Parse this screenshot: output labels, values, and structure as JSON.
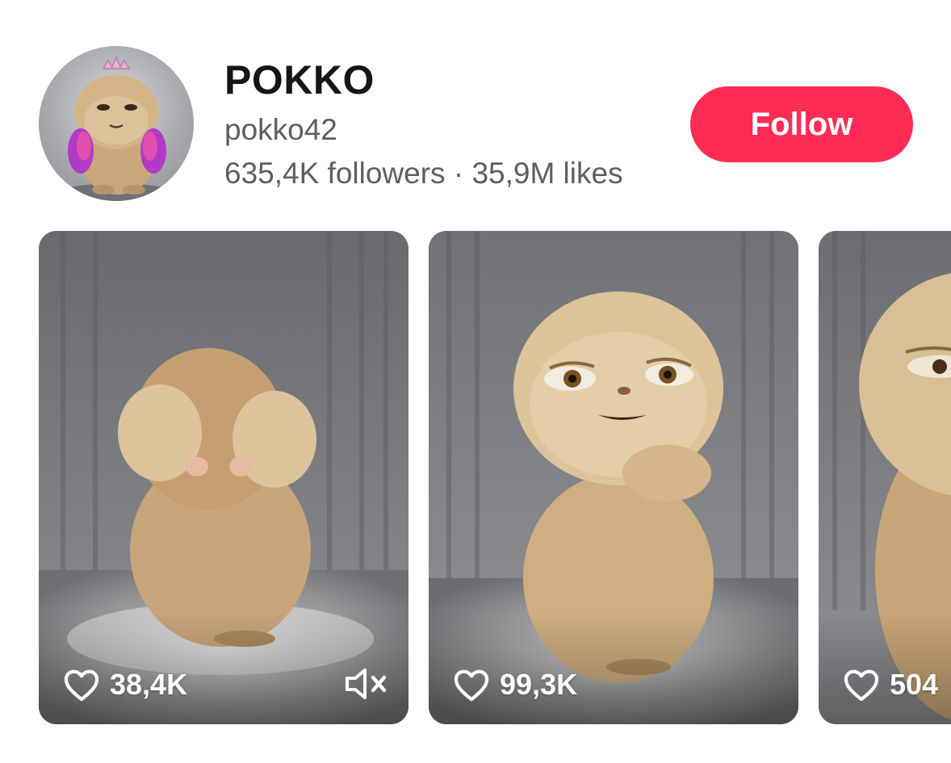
{
  "profile": {
    "name": "POKKO",
    "handle": "pokko42",
    "followers": "635,4K followers",
    "separator": "·",
    "likes": "35,9M likes",
    "follow_label": "Follow"
  },
  "videos": [
    {
      "likes": "38,4K",
      "muted": true
    },
    {
      "likes": "99,3K",
      "muted": false
    },
    {
      "likes": "504"
    }
  ],
  "colors": {
    "follow_button": "#fe2c55",
    "primary_text": "#161616",
    "secondary_text": "#5e5e62"
  },
  "icons": {
    "like": "heart-outline-icon",
    "mute": "speaker-muted-icon"
  }
}
